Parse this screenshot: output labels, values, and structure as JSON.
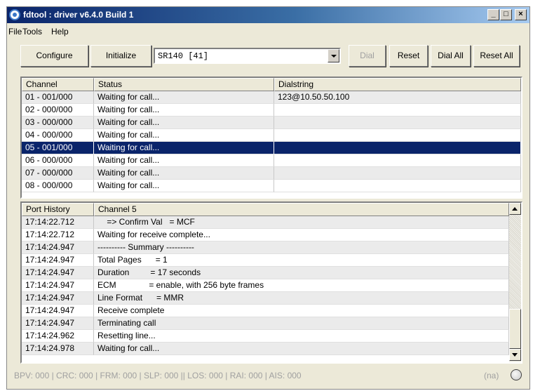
{
  "window": {
    "title": "fdtool : driver v6.4.0 Build 1",
    "controls": {
      "minimize": "_",
      "maximize": "□",
      "close": "×"
    }
  },
  "menu": {
    "items": [
      "File",
      "Tools",
      "Help"
    ]
  },
  "toolbar": {
    "configure": "Configure",
    "initialize": "Initialize",
    "port_select": "SR140 [41]",
    "dial": "Dial",
    "reset": "Reset",
    "dial_all": "Dial All",
    "reset_all": "Reset All"
  },
  "channels": {
    "headers": [
      "Channel",
      "Status",
      "Dialstring"
    ],
    "selected_index": 4,
    "rows": [
      [
        "01 - 001/000",
        "Waiting for call...",
        "123@10.50.50.100"
      ],
      [
        "02 - 000/000",
        "Waiting for call...",
        ""
      ],
      [
        "03 - 000/000",
        "Waiting for call...",
        ""
      ],
      [
        "04 - 000/000",
        "Waiting for call...",
        ""
      ],
      [
        "05 - 001/000",
        "Waiting for call...",
        ""
      ],
      [
        "06 - 000/000",
        "Waiting for call...",
        ""
      ],
      [
        "07 - 000/000",
        "Waiting for call...",
        ""
      ],
      [
        "08 - 000/000",
        "Waiting for call...",
        ""
      ]
    ]
  },
  "history": {
    "headers": [
      "Port History",
      "Channel 5"
    ],
    "selected_index": 11,
    "rows": [
      [
        "17:14:22.712",
        "    => Confirm Val   = MCF"
      ],
      [
        "17:14:22.712",
        "Waiting for receive complete..."
      ],
      [
        "17:14:24.947",
        "---------- Summary ----------"
      ],
      [
        "17:14:24.947",
        "Total Pages      = 1"
      ],
      [
        "17:14:24.947",
        "Duration         = 17 seconds"
      ],
      [
        "17:14:24.947",
        "ECM              = enable, with 256 byte frames"
      ],
      [
        "17:14:24.947",
        "Line Format      = MMR"
      ],
      [
        "17:14:24.947",
        "Receive complete"
      ],
      [
        "17:14:24.947",
        "Terminating call"
      ],
      [
        "17:14:24.962",
        "Resetting line..."
      ],
      [
        "17:14:24.978",
        "Waiting for call..."
      ]
    ]
  },
  "status": {
    "counters": "BPV: 000 | CRC: 000 | FRM: 000 | SLP: 000 || LOS: 000 | RAI: 000 | AIS: 000",
    "state": "(na)"
  },
  "colors": {
    "selection": "#0a246a",
    "title_start": "#0a246a",
    "title_end": "#a6caf0",
    "face": "#ece9d8"
  }
}
